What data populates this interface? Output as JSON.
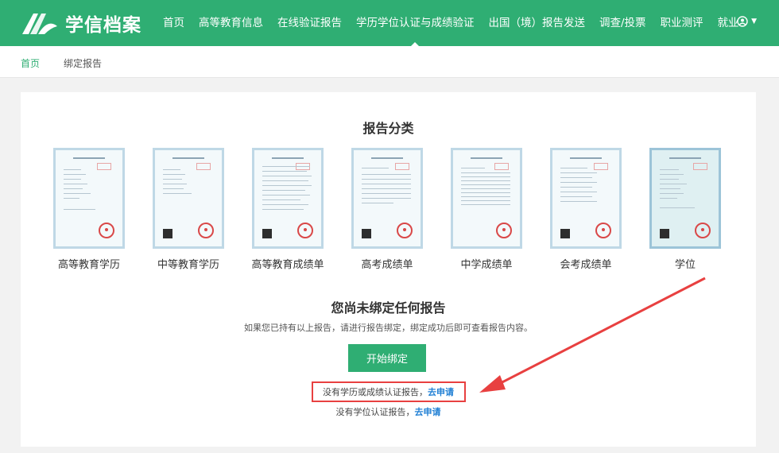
{
  "header": {
    "logo_text": "学信档案",
    "nav": [
      {
        "label": "首页"
      },
      {
        "label": "高等教育信息"
      },
      {
        "label": "在线验证报告"
      },
      {
        "label": "学历学位认证与成绩验证",
        "active": true
      },
      {
        "label": "出国（境）报告发送"
      },
      {
        "label": "调查/投票"
      },
      {
        "label": "职业测评"
      },
      {
        "label": "就业"
      }
    ]
  },
  "breadcrumb": {
    "home": "首页",
    "current": "绑定报告"
  },
  "main": {
    "section_title": "报告分类",
    "reports": [
      {
        "label": "高等教育学历"
      },
      {
        "label": "中等教育学历"
      },
      {
        "label": "高等教育成绩单"
      },
      {
        "label": "高考成绩单"
      },
      {
        "label": "中学成绩单"
      },
      {
        "label": "会考成绩单"
      },
      {
        "label": "学位"
      }
    ],
    "empty_title": "您尚未绑定任何报告",
    "empty_desc": "如果您已持有以上报告，请进行报告绑定，绑定成功后即可查看报告内容。",
    "bind_button": "开始绑定",
    "apply_1_text": "没有学历或成绩认证报告，",
    "apply_1_link": "去申请",
    "apply_2_text": "没有学位认证报告，",
    "apply_2_link": "去申请"
  },
  "colors": {
    "brand": "#2fae73",
    "link": "#1f7fd4",
    "annotation": "#e84040"
  }
}
